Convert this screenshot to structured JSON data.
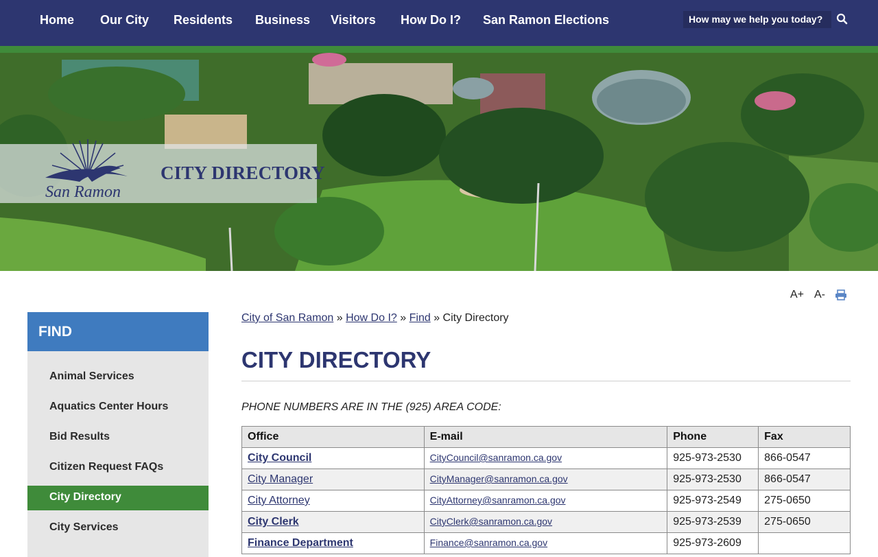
{
  "nav": {
    "items": [
      {
        "label": "Home"
      },
      {
        "label": "Our City"
      },
      {
        "label": "Residents"
      },
      {
        "label": "Business"
      },
      {
        "label": "Visitors"
      },
      {
        "label": "How Do I?"
      },
      {
        "label": "San Ramon Elections"
      }
    ],
    "search_placeholder": "How may we help you today?"
  },
  "hero": {
    "logo_text": "San Ramon",
    "title": "CITY DIRECTORY"
  },
  "tools": {
    "increase": "A+",
    "decrease": "A-"
  },
  "sidebar": {
    "heading": "FIND",
    "items": [
      {
        "label": "Animal Services"
      },
      {
        "label": "Aquatics Center Hours"
      },
      {
        "label": "Bid Results"
      },
      {
        "label": "Citizen Request FAQs"
      },
      {
        "label": "City Directory"
      },
      {
        "label": "City Services"
      }
    ]
  },
  "breadcrumb": {
    "items": [
      "City of San Ramon",
      "How Do I?",
      "Find"
    ],
    "separator": "»",
    "current": "City Directory"
  },
  "main": {
    "title": "CITY DIRECTORY",
    "note": "PHONE NUMBERS ARE IN THE (925) AREA CODE:"
  },
  "table": {
    "headers": [
      "Office",
      "E-mail",
      "Phone",
      "Fax"
    ],
    "rows": [
      {
        "office": "City Council",
        "email": "CityCouncil@sanramon.ca.gov",
        "phone": "925-973-2530",
        "fax": "866-0547"
      },
      {
        "office": "City Manager",
        "email": "CityManager@sanramon.ca.gov",
        "phone": "925-973-2530",
        "fax": "866-0547"
      },
      {
        "office": "City Attorney",
        "email": "CityAttorney@sanramon.ca.gov",
        "phone": "925-973-2549",
        "fax": "275-0650"
      },
      {
        "office": "City Clerk",
        "email": "CityClerk@sanramon.ca.gov",
        "phone": "925-973-2539",
        "fax": "275-0650"
      },
      {
        "office": "Finance Department",
        "email": "Finance@sanramon.ca.gov",
        "phone": "925-973-2609",
        "fax": ""
      }
    ]
  },
  "colors": {
    "navy": "#2d3670",
    "green": "#3f8b3a",
    "blue": "#3f7bbf"
  }
}
